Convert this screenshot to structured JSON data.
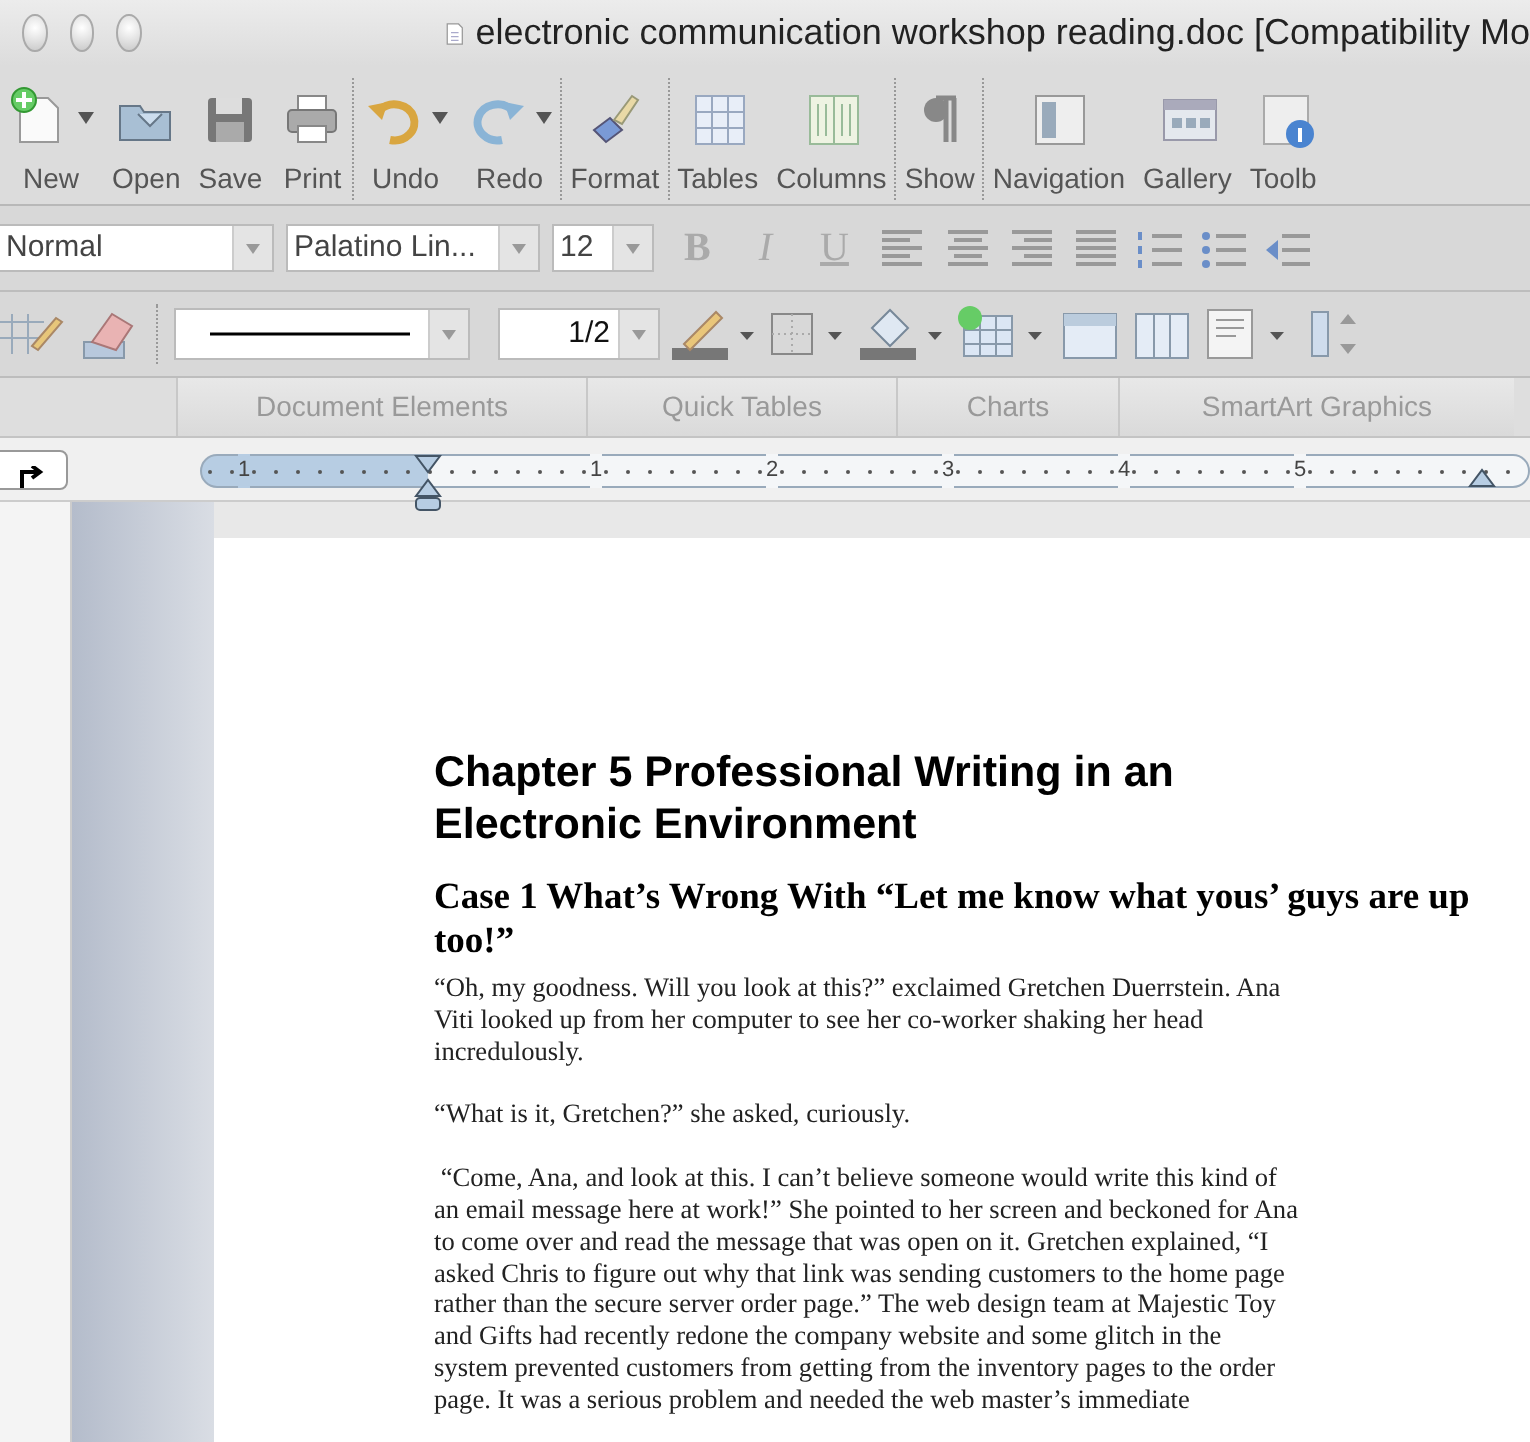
{
  "window": {
    "title": "electronic communication workshop reading.doc [Compatibility Mo"
  },
  "toolbar": [
    {
      "label": "New",
      "menu": true,
      "sep_after": false
    },
    {
      "label": "Open",
      "menu": false,
      "sep_after": false
    },
    {
      "label": "Save",
      "menu": false,
      "sep_after": false
    },
    {
      "label": "Print",
      "menu": false,
      "sep_after": true
    },
    {
      "label": "Undo",
      "menu": true,
      "sep_after": false
    },
    {
      "label": "Redo",
      "menu": true,
      "sep_after": true
    },
    {
      "label": "Format",
      "menu": false,
      "sep_after": true
    },
    {
      "label": "Tables",
      "menu": false,
      "sep_after": false
    },
    {
      "label": "Columns",
      "menu": false,
      "sep_after": true
    },
    {
      "label": "Show",
      "menu": false,
      "sep_after": true
    },
    {
      "label": "Navigation",
      "menu": false,
      "sep_after": false
    },
    {
      "label": "Gallery",
      "menu": false,
      "sep_after": false
    },
    {
      "label": "Toolb",
      "menu": false,
      "sep_after": false
    }
  ],
  "formatting": {
    "style": "Normal",
    "font": "Palatino Lin...",
    "size": "12",
    "buttons": [
      {
        "kind": "bold",
        "label": "B",
        "disabled": true
      },
      {
        "kind": "italic",
        "label": "I",
        "disabled": true
      },
      {
        "kind": "underline",
        "label": "U",
        "disabled": true
      }
    ]
  },
  "line_weight": "1/2",
  "gallery_tabs": [
    {
      "label": "Document Elements",
      "selected": false
    },
    {
      "label": "Quick Tables",
      "selected": false
    },
    {
      "label": "Charts",
      "selected": false
    },
    {
      "label": "SmartArt Graphics",
      "selected": false
    }
  ],
  "ruler": {
    "labels": [
      "1",
      "1",
      "2",
      "3",
      "4",
      "5"
    ]
  },
  "document": {
    "title": "Chapter 5 Professional Writing in an Electronic Environment",
    "case_heading": "Case 1 What’s Wrong With “Let me know what yous’ guys are up too!”",
    "paragraphs": [
      {
        "lines": [
          "“Oh, my goodness. Will you look at this?” exclaimed Gretchen Duerrstein. Ana",
          "Viti looked up from her computer to see her co-worker shaking her head",
          "incredulously."
        ]
      },
      {
        "lines": [
          "“What is it, Gretchen?” she asked, curiously."
        ]
      },
      {
        "lines": [
          " “Come, Ana, and look at this. I can’t believe someone would write this kind of",
          "an email message here at work!” She pointed to her screen and beckoned for Ana",
          "to come over and read the message that was open on it. Gretchen explained, “I",
          "asked Chris to figure out why that link was sending customers to the home page",
          "rather than the secure server order page.” The web design team at Majestic Toy",
          "and Gifts had recently redone the company website and some glitch in the",
          "system prevented customers from getting from the inventory pages to the order",
          "page. It was a serious problem and needed the web master’s immediate"
        ]
      }
    ]
  }
}
